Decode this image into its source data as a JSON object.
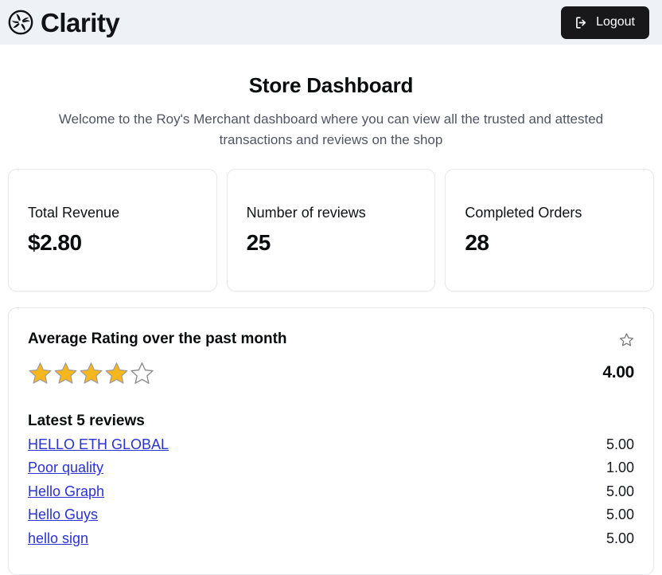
{
  "header": {
    "logo_icon": "pinwheel-logo-icon",
    "brand": "Clarity",
    "logout_label": "Logout",
    "logout_icon": "logout-arrow-icon",
    "background_color": "#eef1f6",
    "logout_bg_color": "#18181b"
  },
  "hero": {
    "title": "Store Dashboard",
    "subtitle": "Welcome to the Roy's Merchant dashboard where you can view all the trusted and attested transactions and reviews on the shop"
  },
  "stats": [
    {
      "label": "Total Revenue",
      "value": "$2.80"
    },
    {
      "label": "Number of reviews",
      "value": "25"
    },
    {
      "label": "Completed Orders",
      "value": "28"
    }
  ],
  "rating_panel": {
    "title": "Average Rating over the past month",
    "corner_icon": "star-outline-icon",
    "stars_filled": 4,
    "stars_total": 5,
    "star_fill_color": "#F6B71C",
    "star_outline_color": "#868686",
    "rating_value": "4.00",
    "reviews_heading": "Latest 5 reviews",
    "reviews": [
      {
        "title": "HELLO ETH GLOBAL",
        "score": "5.00"
      },
      {
        "title": "Poor quality",
        "score": "1.00"
      },
      {
        "title": "Hello Graph",
        "score": "5.00"
      },
      {
        "title": "Hello Guys",
        "score": "5.00"
      },
      {
        "title": "hello sign",
        "score": "5.00"
      }
    ],
    "link_color": "#2b32d4"
  }
}
